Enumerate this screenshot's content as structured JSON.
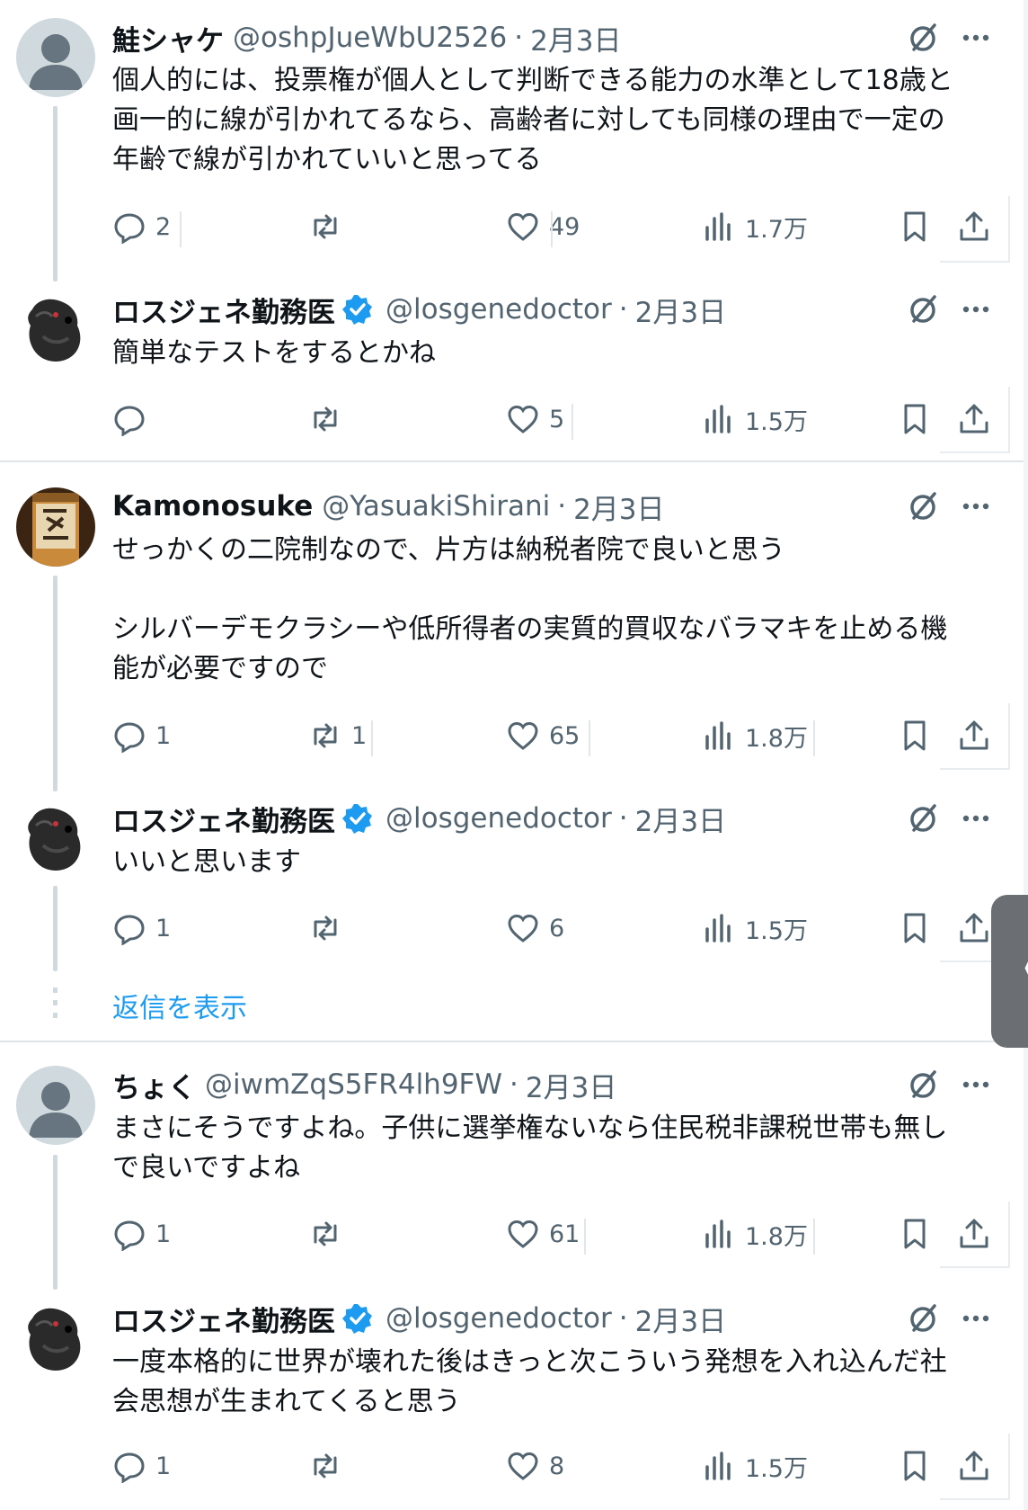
{
  "posts": [
    {
      "name": "鮭シャケ",
      "handle": "@oshpJueWbU2526",
      "sep": "·",
      "date": "2月3日",
      "verified": false,
      "avatar": "default",
      "lines": [
        "個人的には、投票権が個人として判断できる能力の水準として18歳と",
        "画一的に線が引かれてるなら、高齢者に対しても同様の理由で一定の",
        "年齢で線が引かれていいと思ってる"
      ],
      "replies": "2",
      "retweets": "",
      "likes": "49",
      "views": "1.7万"
    },
    {
      "name": "ロスジェネ勤務医",
      "handle": "@losgenedoctor",
      "sep": "·",
      "date": "2月3日",
      "verified": true,
      "avatar": "dog",
      "lines": [
        "簡単なテストをするとかね"
      ],
      "replies": "",
      "retweets": "",
      "likes": "5",
      "views": "1.5万"
    },
    {
      "name": "Kamonosuke",
      "handle": "@YasuakiShirani",
      "sep": "·",
      "date": "2月3日",
      "verified": false,
      "avatar": "bottle",
      "lines": [
        "せっかくの二院制なので、片方は納税者院で良いと思う",
        "",
        "シルバーデモクラシーや低所得者の実質的買収なバラマキを止める機",
        "能が必要ですので"
      ],
      "replies": "1",
      "retweets": "1",
      "likes": "65",
      "views": "1.8万"
    },
    {
      "name": "ロスジェネ勤務医",
      "handle": "@losgenedoctor",
      "sep": "·",
      "date": "2月3日",
      "verified": true,
      "avatar": "dog",
      "lines": [
        "いいと思います"
      ],
      "replies": "1",
      "retweets": "",
      "likes": "6",
      "views": "1.5万"
    },
    {
      "name": "ちょく",
      "handle": "@iwmZqS5FR4lh9FW",
      "sep": "·",
      "date": "2月3日",
      "verified": false,
      "avatar": "default",
      "lines": [
        "まさにそうですよね。子供に選挙権ないなら住民税非課税世帯も無し",
        "で良いですよね"
      ],
      "replies": "1",
      "retweets": "",
      "likes": "61",
      "views": "1.8万"
    },
    {
      "name": "ロスジェネ勤務医",
      "handle": "@losgenedoctor",
      "sep": "·",
      "date": "2月3日",
      "verified": true,
      "avatar": "dog",
      "lines": [
        "一度本格的に世界が壊れた後はきっと次こういう発想を入れ込んだ社",
        "会思想が生まれてくると思う"
      ],
      "replies": "1",
      "retweets": "",
      "likes": "8",
      "views": "1.5万"
    }
  ],
  "show_replies": "返信を表示",
  "side_tab_glyph": "《",
  "colors": {
    "text": "#0f1419",
    "secondary": "#536471",
    "accent": "#1d9bf0",
    "thread_line": "#cfd9de",
    "divider": "#dfe4e8"
  }
}
